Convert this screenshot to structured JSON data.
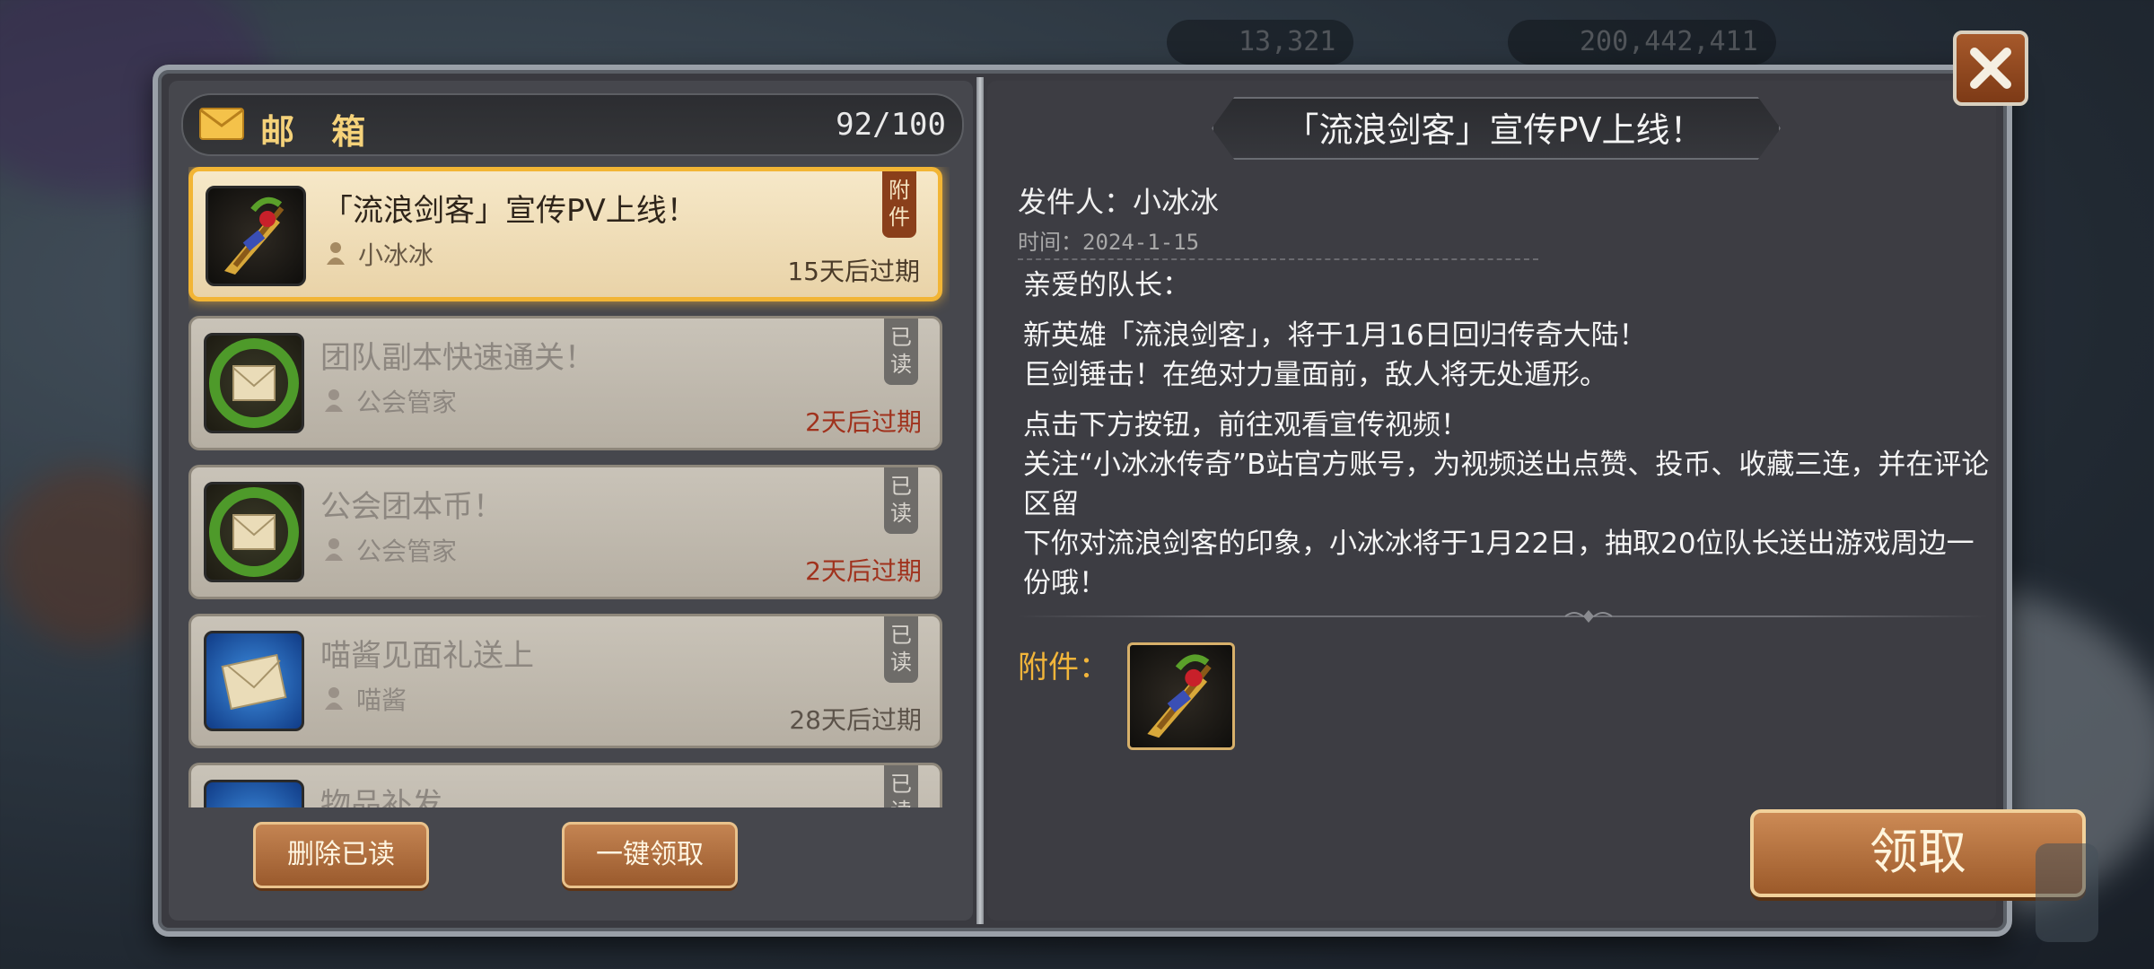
{
  "background": {
    "resources": [
      {
        "icon": "diamond-icon",
        "value": "13,321"
      },
      {
        "icon": "gold-coin-icon",
        "value": "200,442,411"
      }
    ]
  },
  "mailbox": {
    "title": "邮 箱",
    "count": "92/100",
    "items": [
      {
        "title": "「流浪剑客」宣传PV上线！",
        "sender": "小冰冰",
        "expiry": "15天后过期",
        "badge": "附件",
        "state": "selected",
        "thumb": "weapon-bundle-icon"
      },
      {
        "title": "团队副本快速通关！",
        "sender": "公会管家",
        "expiry": "2天后过期",
        "badge": "已读",
        "state": "read",
        "thumb": "guild-envelope-icon"
      },
      {
        "title": "公会团本币！",
        "sender": "公会管家",
        "expiry": "2天后过期",
        "badge": "已读",
        "state": "read",
        "thumb": "guild-envelope-icon"
      },
      {
        "title": "喵酱见面礼送上",
        "sender": "喵酱",
        "expiry": "28天后过期",
        "badge": "已读",
        "state": "read",
        "thumb": "blue-envelope-icon"
      },
      {
        "title": "物品补发",
        "sender": "",
        "expiry": "",
        "badge": "已读",
        "state": "read",
        "thumb": "blue-envelope-icon"
      }
    ],
    "delete_read_label": "删除已读",
    "claim_all_label": "一键领取"
  },
  "message": {
    "title": "「流浪剑客」宣传PV上线！",
    "sender_line": "发件人：小冰冰",
    "time_line": "时间：2024-1-15",
    "greeting": "亲爱的队长：",
    "para1_line1": "新英雄「流浪剑客」，将于1月16日回归传奇大陆！",
    "para1_line2": "巨剑锤击！在绝对力量面前，敌人将无处遁形。",
    "para2_line1": "点击下方按钮，前往观看宣传视频！",
    "para2_line2": "关注“小冰冰传奇”B站官方账号，为视频送出点赞、投币、收藏三连，并在评论区留",
    "para2_line3": "下你对流浪剑客的印象，小冰冰将于1月22日，抽取20位队长送出游戏周边一份哦！",
    "attachment_label": "附件：",
    "claim_label": "领取"
  },
  "colors": {
    "accent_gold": "#f2b53a",
    "expiry_red": "#a0321d",
    "button_brown": "#9c5a2a"
  }
}
